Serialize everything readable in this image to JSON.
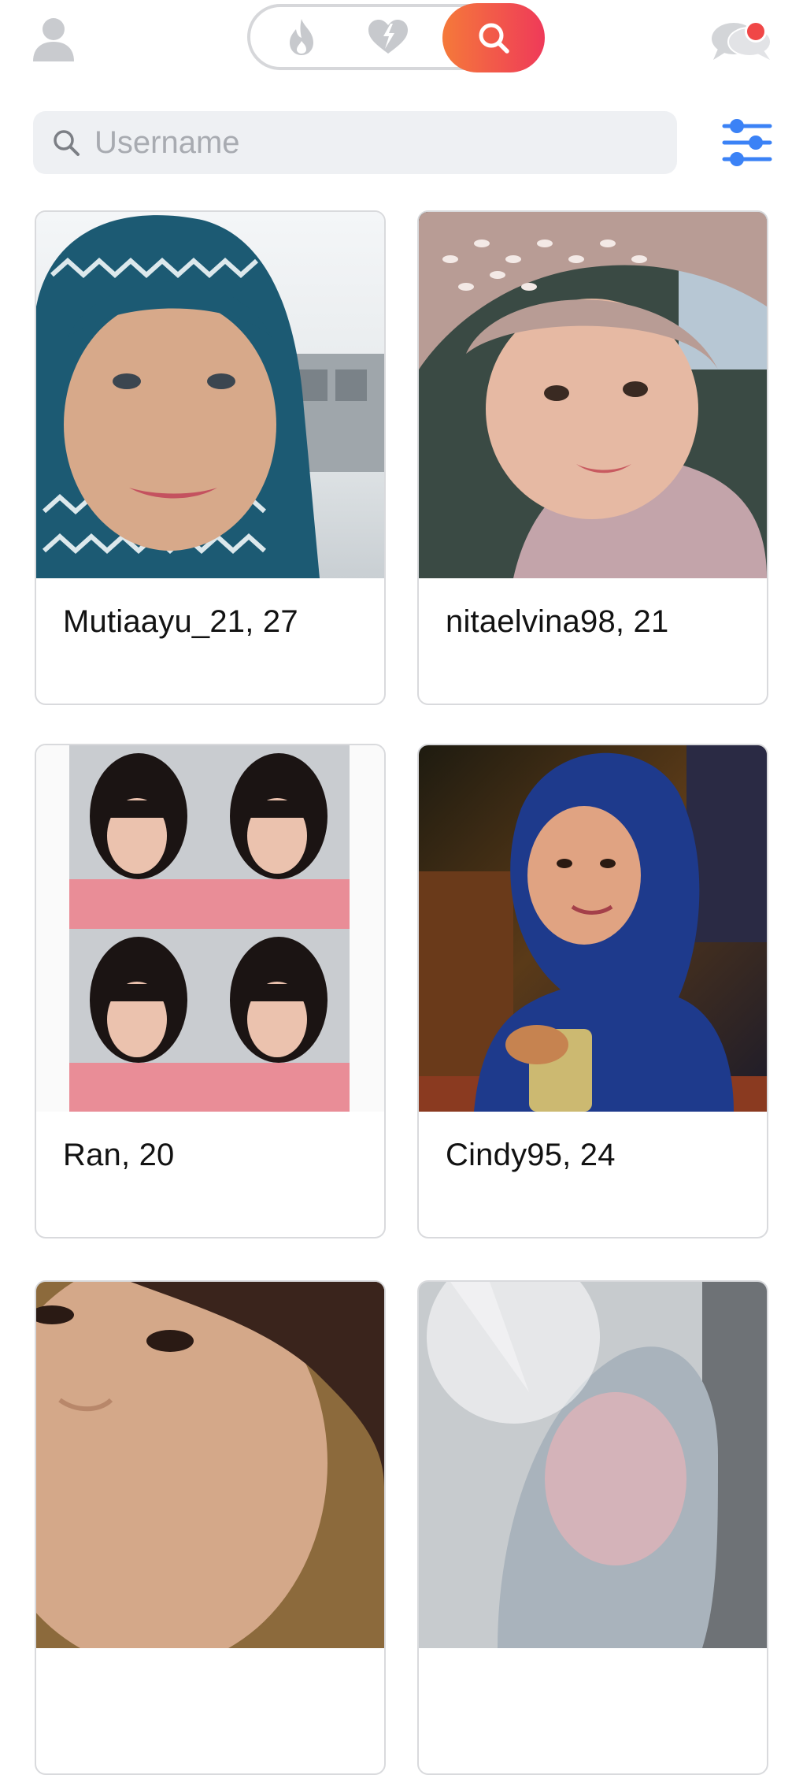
{
  "header": {
    "tabs": [
      {
        "name": "hot",
        "icon": "flame-icon"
      },
      {
        "name": "likes",
        "icon": "lightning-heart-icon"
      },
      {
        "name": "search",
        "icon": "search-icon",
        "active": true
      }
    ],
    "chat_badge": true
  },
  "search": {
    "placeholder": "Username",
    "value": ""
  },
  "profiles": [
    {
      "caption": "Mutiaayu_21, 27"
    },
    {
      "caption": "nitaelvina98, 21"
    },
    {
      "caption": "Ran, 20"
    },
    {
      "caption": "Cindy95, 24"
    },
    {
      "caption": ""
    },
    {
      "caption": ""
    }
  ],
  "colors": {
    "accent_start": "#f5793a",
    "accent_end": "#ef3a59",
    "filter_blue": "#3b82f6",
    "inactive_icon": "#c7c9cd",
    "badge_red": "#f04747"
  }
}
